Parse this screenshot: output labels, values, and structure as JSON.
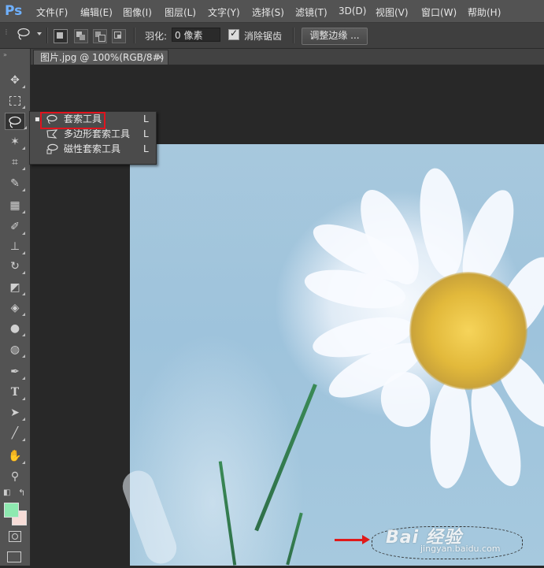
{
  "app": {
    "logo": "Ps"
  },
  "menubar": {
    "items": [
      "文件(F)",
      "编辑(E)",
      "图像(I)",
      "图层(L)",
      "文字(Y)",
      "选择(S)",
      "滤镜(T)",
      "3D(D)",
      "视图(V)",
      "窗口(W)",
      "帮助(H)"
    ]
  },
  "options": {
    "feather_label": "羽化:",
    "feather_value": "0 像素",
    "antialias_label": "消除锯齿",
    "antialias_checked": true,
    "refine_button": "调整边缘 ..."
  },
  "document_tab": {
    "title": "图片.jpg @ 100%(RGB/8#)",
    "close": "×"
  },
  "tools": {
    "icons": [
      "move-icon",
      "marquee-icon",
      "lasso-icon",
      "magic-wand-icon",
      "crop-icon",
      "eyedropper-icon",
      "healing-brush-icon",
      "brush-icon",
      "clone-stamp-icon",
      "history-brush-icon",
      "eraser-icon",
      "paint-bucket-icon",
      "blur-icon",
      "dodge-icon",
      "pen-icon",
      "type-icon",
      "path-selection-icon",
      "line-icon",
      "hand-icon",
      "zoom-icon"
    ],
    "active": "lasso-icon",
    "foreground_color": "#8ee9b0",
    "background_color": "#f7dcd7"
  },
  "flyout": {
    "items": [
      {
        "label": "套索工具",
        "key": "L",
        "icon": "lasso-icon",
        "selected": true
      },
      {
        "label": "多边形套索工具",
        "key": "L",
        "icon": "polygonal-lasso-icon",
        "selected": false
      },
      {
        "label": "磁性套索工具",
        "key": "L",
        "icon": "magnetic-lasso-icon",
        "selected": false
      }
    ],
    "highlight_color": "#e0141e"
  },
  "watermark": {
    "brand": "Bai 经验",
    "url": "jingyan.baidu.com"
  }
}
